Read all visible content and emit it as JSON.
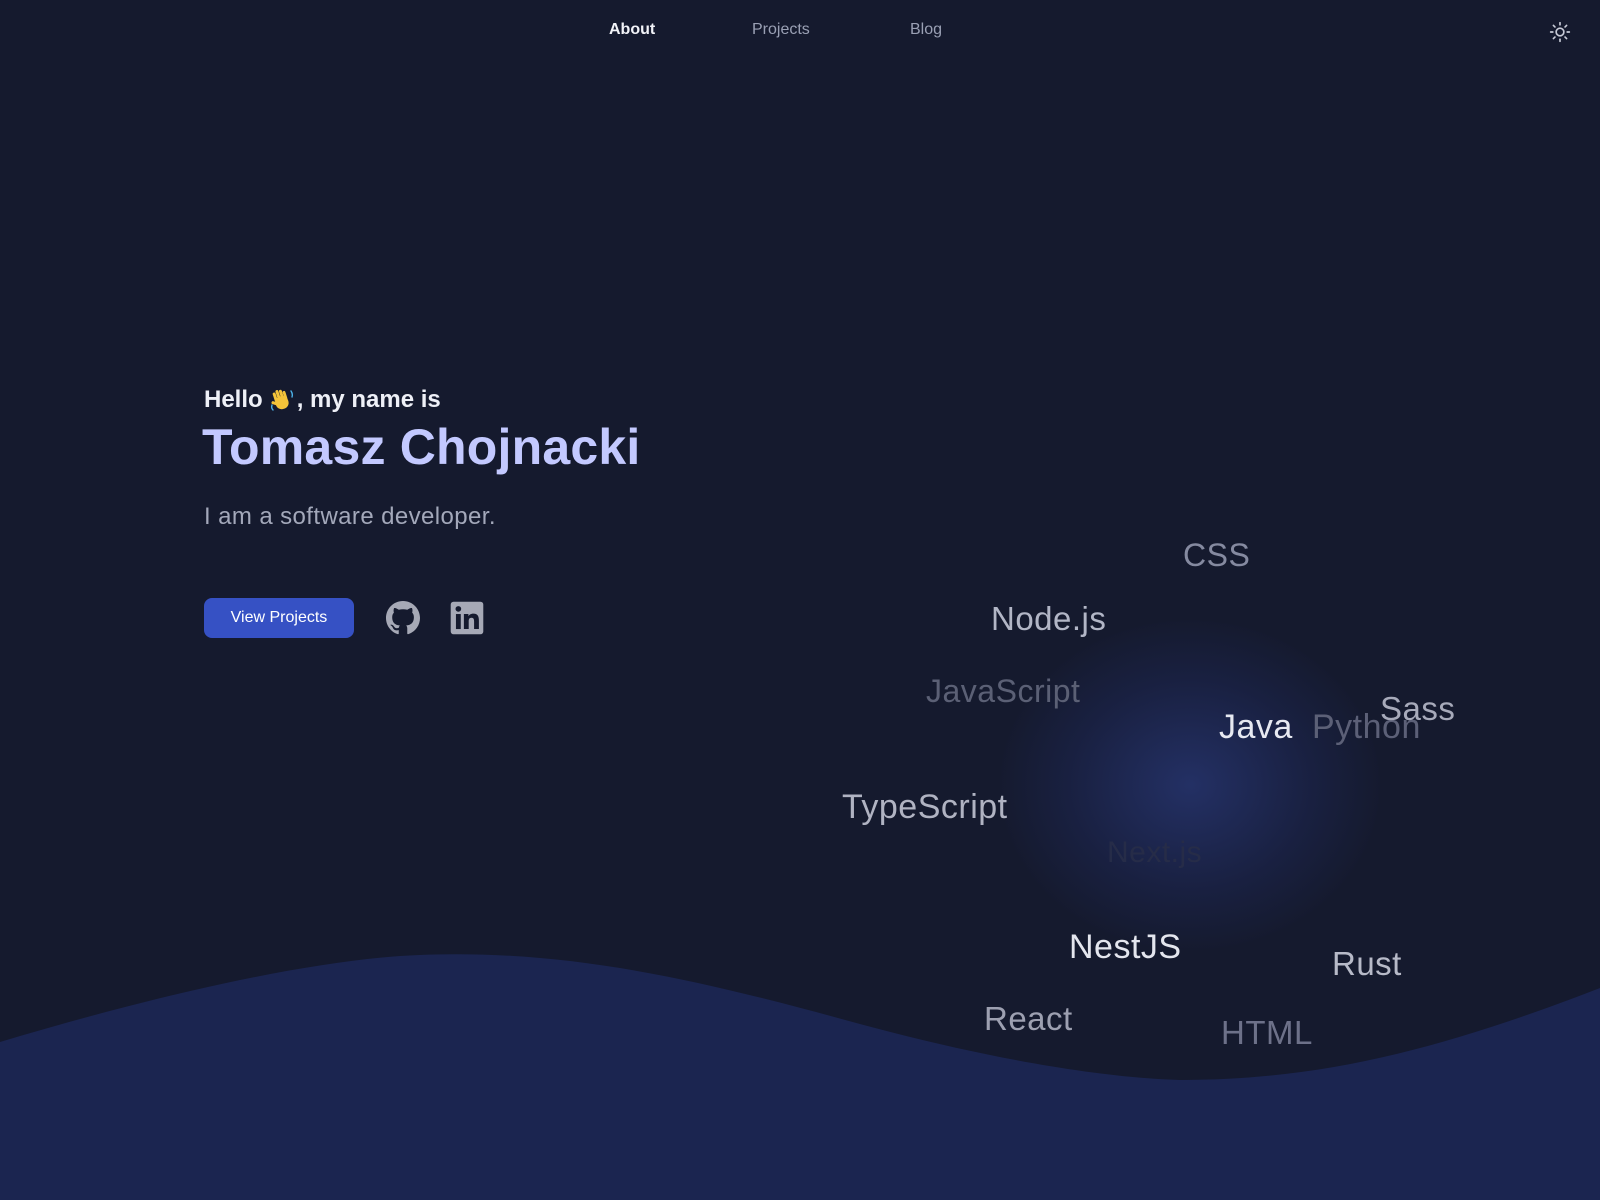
{
  "nav": {
    "links": [
      {
        "label": "About",
        "active": true
      },
      {
        "label": "Projects",
        "active": false
      },
      {
        "label": "Blog",
        "active": false
      }
    ],
    "theme_icon": "sun-icon"
  },
  "hero": {
    "greeting_before": "Hello",
    "greeting_emoji": "waving-hand-icon",
    "greeting_after": ", my name is",
    "name": "Tomasz Chojnacki",
    "tagline": "I am a software developer.",
    "cta_label": "View Projects",
    "socials": [
      "github-icon",
      "linkedin-icon"
    ]
  },
  "tag_cloud": {
    "tags": [
      "CSS",
      "Node.js",
      "JavaScript",
      "Java",
      "Python",
      "Sass",
      "TypeScript",
      "Next.js",
      "NestJS",
      "Rust",
      "React",
      "HTML"
    ]
  },
  "colors": {
    "background": "#151a2e",
    "wave": "#1b2550",
    "accent": "#3651c4",
    "name": "#c3c9ff"
  }
}
